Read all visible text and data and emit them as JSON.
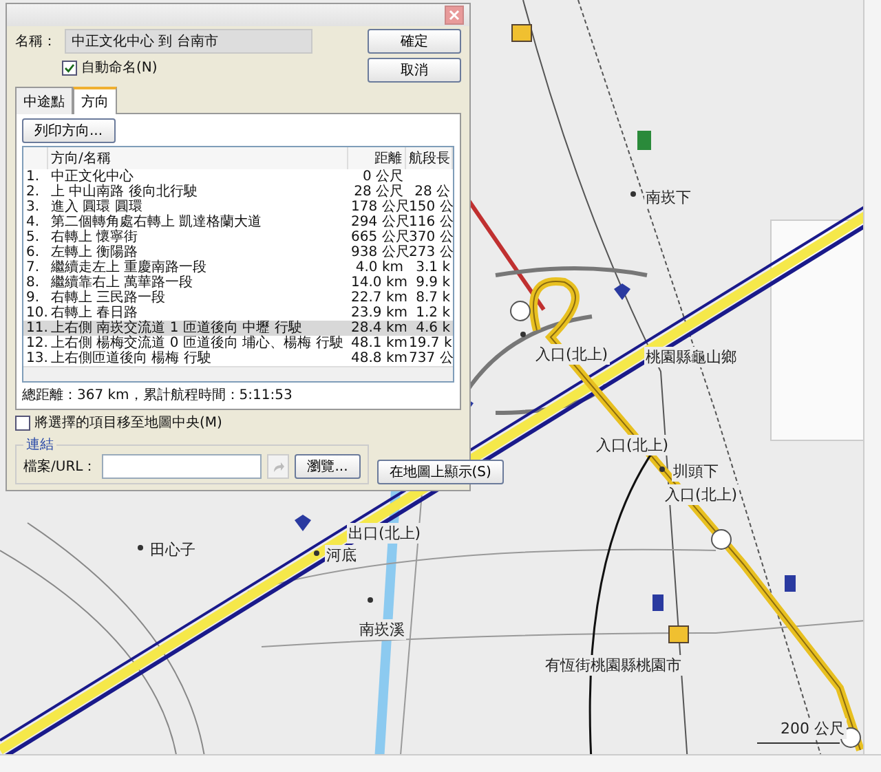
{
  "dialog": {
    "name_label": "名稱：",
    "name_value": "中正文化中心 到 台南市",
    "auto_name": {
      "label": "自動命名(N)",
      "checked": true
    },
    "ok_button": "確定",
    "cancel_button": "取消",
    "tabs": [
      {
        "label": "中途點",
        "selected": false
      },
      {
        "label": "方向",
        "selected": true
      }
    ],
    "print_button": "列印方向...",
    "table": {
      "columns": [
        "方向/名稱",
        "距離",
        "航段長"
      ],
      "rows": [
        {
          "index": "1.",
          "direction": "中正文化中心",
          "distance": "0 公尺",
          "leg": "",
          "selected": false
        },
        {
          "index": "2.",
          "direction": "上 中山南路 後向北行駛",
          "distance": "28 公尺",
          "leg": "28 公",
          "selected": false
        },
        {
          "index": "3.",
          "direction": "進入 圓環 圓環",
          "distance": "178 公尺",
          "leg": "150 公",
          "selected": false
        },
        {
          "index": "4.",
          "direction": "第二個轉角處右轉上 凱達格蘭大道",
          "distance": "294 公尺",
          "leg": "116 公",
          "selected": false
        },
        {
          "index": "5.",
          "direction": "右轉上 懷寧街",
          "distance": "665 公尺",
          "leg": "370 公",
          "selected": false
        },
        {
          "index": "6.",
          "direction": "左轉上 衡陽路",
          "distance": "938 公尺",
          "leg": "273 公",
          "selected": false
        },
        {
          "index": "7.",
          "direction": "繼續走左上 重慶南路一段",
          "distance": "4.0 km",
          "leg": "3.1 k",
          "selected": false
        },
        {
          "index": "8.",
          "direction": "繼續靠右上 萬華路一段",
          "distance": "14.0 km",
          "leg": "9.9 k",
          "selected": false
        },
        {
          "index": "9.",
          "direction": "右轉上 三民路一段",
          "distance": "22.7 km",
          "leg": "8.7 k",
          "selected": false
        },
        {
          "index": "10.",
          "direction": "右轉上 春日路",
          "distance": "23.9 km",
          "leg": "1.2 k",
          "selected": false
        },
        {
          "index": "11.",
          "direction": "上右側 南崁交流道 1 匝道後向 中壢 行駛",
          "distance": "28.4 km",
          "leg": "4.6 k",
          "selected": true
        },
        {
          "index": "12.",
          "direction": "上右側 楊梅交流道 0 匝道後向 埔心、楊梅 行駛",
          "distance": "48.1 km",
          "leg": "19.7 k",
          "selected": false
        },
        {
          "index": "13.",
          "direction": "上右側匝道後向 楊梅 行駛",
          "distance": "48.8 km",
          "leg": "737 公",
          "selected": false
        }
      ]
    },
    "summary": "總距離：367 km，累計航程時間：5:11:53",
    "center_option": {
      "label": "將選擇的項目移至地圖中央(M)",
      "checked": false
    },
    "link_group": {
      "title": "連結",
      "file_label": "檔案/URL：",
      "browse_button": "瀏覽..."
    },
    "show_on_map_button": "在地圖上顯示(S)"
  },
  "map": {
    "labels": [
      "南崁下",
      "入口(北上)",
      "桃園縣龜山鄉",
      "入口(北上)",
      "圳頭下",
      "入口(北上)",
      "田心子",
      "出口(北上)",
      "河底",
      "南崁溪",
      "有恆街桃園縣桃園市",
      "200 公尺"
    ]
  }
}
